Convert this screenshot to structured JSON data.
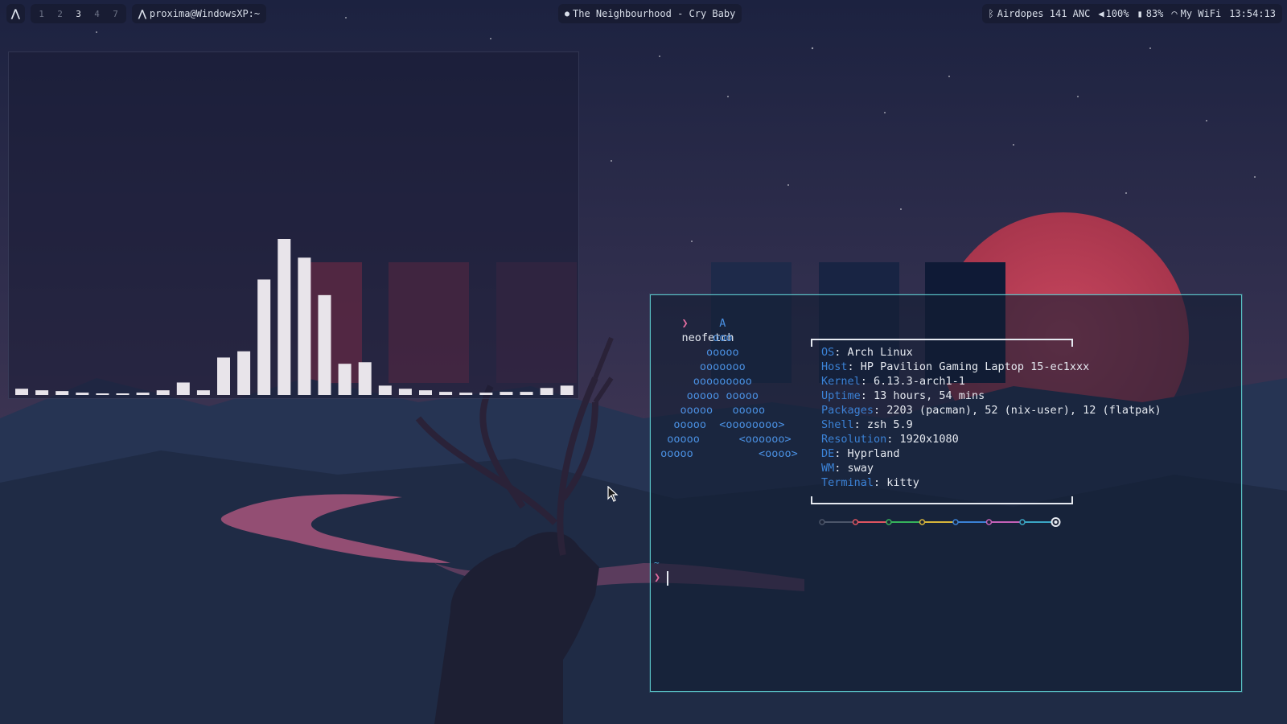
{
  "topbar": {
    "launcher_icon": "arch-icon",
    "workspaces": [
      {
        "label": "1",
        "active": false
      },
      {
        "label": "2",
        "active": false
      },
      {
        "label": "3",
        "active": true
      },
      {
        "label": "4",
        "active": false
      },
      {
        "label": "7",
        "active": false
      }
    ],
    "window_title": "proxima@WindowsXP:~",
    "media": "The Neighbourhood - Cry Baby",
    "bluetooth": "Airdopes 141 ANC",
    "volume": "100%",
    "battery": "83%",
    "wifi": "My WiFi",
    "clock": "13:54:13"
  },
  "visualizer": {
    "bar_levels": [
      0.04,
      0.03,
      0.025,
      0.015,
      0.01,
      0.01,
      0.015,
      0.03,
      0.08,
      0.03,
      0.24,
      0.28,
      0.74,
      1.0,
      0.88,
      0.64,
      0.2,
      0.21,
      0.06,
      0.04,
      0.03,
      0.02,
      0.015,
      0.015,
      0.02,
      0.02,
      0.045,
      0.06
    ],
    "bar_color": "#e8e4ea"
  },
  "terminal": {
    "command_prompt": "❯",
    "command": "neofetch",
    "logo_lines": [
      "          A",
      "         ooo",
      "        ooooo",
      "       ooooooo",
      "      ooooooooo",
      "     ooooo ooooo",
      "    ooooo   ooooo",
      "   ooooo  <oooooooo>",
      "  ooooo      <oooooo>",
      " ooooo          <oooo>"
    ],
    "info": [
      {
        "key": "OS",
        "value": "Arch Linux"
      },
      {
        "key": "Host",
        "value": "HP Pavilion Gaming Laptop 15-ec1xxx"
      },
      {
        "key": "Kernel",
        "value": "6.13.3-arch1-1"
      },
      {
        "key": "Uptime",
        "value": "13 hours, 54 mins"
      },
      {
        "key": "Packages",
        "value": "2203 (pacman), 52 (nix-user), 12 (flatpak)"
      },
      {
        "key": "Shell",
        "value": "zsh 5.9"
      },
      {
        "key": "Resolution",
        "value": "1920x1080"
      },
      {
        "key": "DE",
        "value": "Hyprland"
      },
      {
        "key": "WM",
        "value": "sway"
      },
      {
        "key": "Terminal",
        "value": "kitty"
      }
    ],
    "palette": [
      "#4c566a",
      "#e05561",
      "#36b35c",
      "#d7b53a",
      "#3b82d6",
      "#c561b8",
      "#3ba6c4",
      "#e5e9f0"
    ],
    "cwd": "~",
    "prompt": "❯"
  },
  "colors": {
    "accent": "#59c2c6",
    "prompt": "#e06c9f",
    "key": "#3b82d6"
  }
}
